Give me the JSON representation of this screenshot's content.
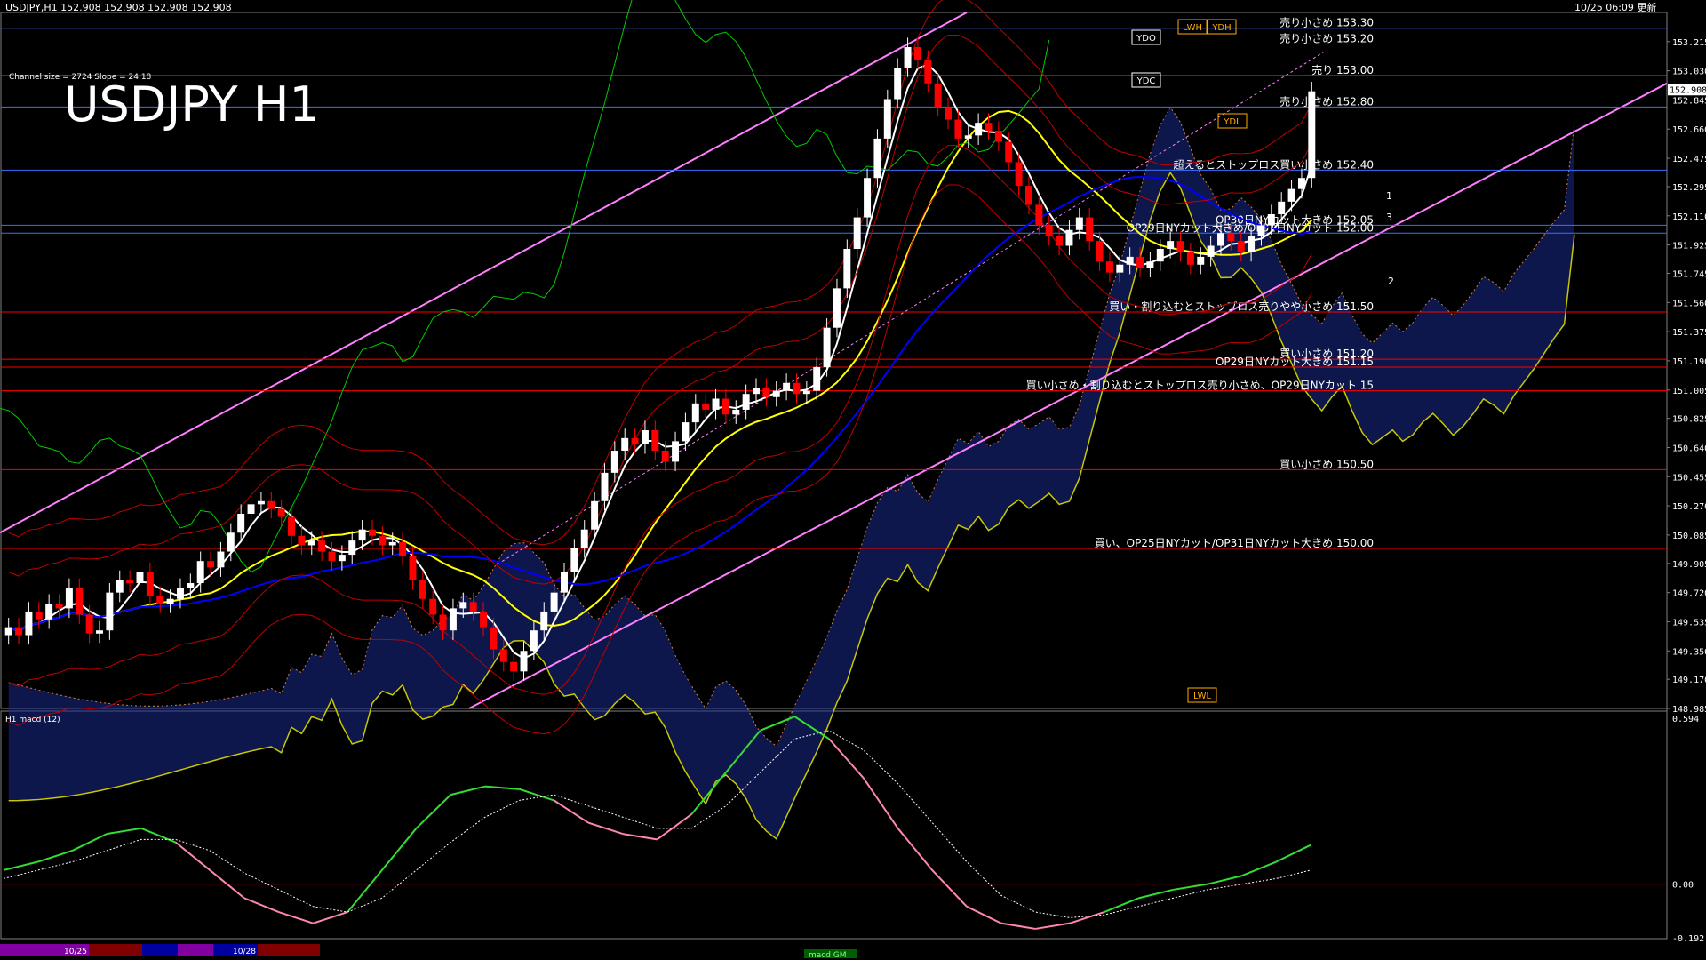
{
  "header": {
    "symbol_info": "USDJPY,H1  152.908 152.908 152.908 152.908",
    "timestamp": "10/25 06:09 更新",
    "channel_info": "Channel size = 2724 Slope = 24.18",
    "big_title": "USDJPY H1",
    "macd_label": "H1  macd (12)",
    "bottom_label": "macd GM",
    "bottom_dates": [
      "10/25",
      "10/28"
    ]
  },
  "chart_data": [
    {
      "type": "candlestick",
      "title": "USDJPY H1",
      "ylim": [
        148.985,
        153.4
      ],
      "y_ticks": [
        "153.215",
        "153.030",
        "152.845",
        "152.660",
        "152.475",
        "152.295",
        "152.110",
        "151.925",
        "151.745",
        "151.560",
        "151.375",
        "151.190",
        "151.005",
        "150.825",
        "150.640",
        "150.455",
        "150.270",
        "150.085",
        "149.905",
        "149.720",
        "149.535",
        "149.350",
        "149.170",
        "148.985"
      ],
      "current_price": "152.908",
      "current_price_value": 152.908,
      "candles": [
        149.5,
        149.45,
        149.6,
        149.55,
        149.65,
        149.62,
        149.75,
        149.58,
        149.46,
        149.48,
        149.72,
        149.8,
        149.78,
        149.85,
        149.7,
        149.65,
        149.68,
        149.75,
        149.78,
        149.92,
        149.88,
        149.98,
        150.1,
        150.22,
        150.28,
        150.3,
        150.25,
        150.2,
        150.08,
        150.02,
        150.05,
        149.98,
        149.92,
        149.96,
        150.05,
        150.12,
        150.08,
        150.02,
        150.04,
        149.95,
        149.8,
        149.68,
        149.58,
        149.48,
        149.62,
        149.66,
        149.6,
        149.5,
        149.36,
        149.28,
        149.22,
        149.35,
        149.48,
        149.6,
        149.72,
        149.85,
        150.0,
        150.12,
        150.3,
        150.48,
        150.62,
        150.7,
        150.66,
        150.75,
        150.62,
        150.55,
        150.68,
        150.8,
        150.92,
        150.88,
        150.95,
        150.85,
        150.88,
        150.98,
        151.02,
        150.96,
        151.0,
        151.05,
        150.98,
        151.0,
        151.15,
        151.4,
        151.65,
        151.9,
        152.1,
        152.35,
        152.6,
        152.85,
        153.05,
        153.18,
        153.1,
        152.95,
        152.8,
        152.72,
        152.6,
        152.62,
        152.7,
        152.65,
        152.58,
        152.45,
        152.3,
        152.18,
        152.05,
        151.98,
        151.92,
        152.02,
        152.1,
        151.95,
        151.82,
        151.75,
        151.8,
        151.85,
        151.78,
        151.82,
        151.9,
        151.95,
        151.88,
        151.8,
        151.85,
        151.92,
        152.0,
        151.95,
        151.88,
        151.98,
        152.05,
        152.12,
        152.2,
        152.28,
        152.35,
        152.9
      ],
      "level_lines": [
        {
          "price": 153.3,
          "label": "売り小さめ 153.30",
          "color": "#3b6fff"
        },
        {
          "price": 153.2,
          "label": "売り小さめ 153.20",
          "color": "#3b6fff"
        },
        {
          "price": 153.0,
          "label": "売り 153.00",
          "color": "#3b6fff"
        },
        {
          "price": 152.8,
          "label": "売り小さめ 152.80",
          "color": "#3b6fff"
        },
        {
          "price": 152.4,
          "label": "超えるとストップロス買い小さめ 152.40",
          "color": "#3b6fff"
        },
        {
          "price": 152.05,
          "label": "OP30日NYカット大きめ 152.05",
          "color": "#3b6fff"
        },
        {
          "price": 152.0,
          "label": "OP29日NYカット大きめ/OP31日NYカット 152.00",
          "color": "#3b6fff"
        },
        {
          "price": 151.5,
          "label": "買い・割り込むとストップロス売りやや小さめ 151.50",
          "color": "#ff0000"
        },
        {
          "price": 151.2,
          "label": "買い小さめ 151.20",
          "color": "#ff0000"
        },
        {
          "price": 151.15,
          "label": "OP29日NYカット大きめ 151.15",
          "color": "#ff0000"
        },
        {
          "price": 151.0,
          "label": "買い小さめ・割り込むとストップロス売り小さめ、OP29日NYカット 15",
          "color": "#ff0000"
        },
        {
          "price": 150.5,
          "label": "買い小さめ 150.50",
          "color": "#ff0000"
        },
        {
          "price": 150.0,
          "label": "買い、OP25日NYカット/OP31日NYカット大きめ 150.00",
          "color": "#ff0000"
        }
      ],
      "markers": [
        "YDO",
        "LWH",
        "YDH",
        "YDC",
        "YDL",
        "LWL"
      ],
      "fib_marks": [
        "1",
        "2",
        "3"
      ],
      "colors": {
        "up": "#ffffff",
        "down": "#ff0000",
        "channel": "#ff80ff",
        "ma_short": "#ffffff",
        "ma_mid": "#ffff00",
        "ma_long": "#0000ff",
        "green": "#00cc00"
      }
    },
    {
      "type": "line",
      "title": "H1  macd (12)",
      "ylim": [
        -0.192,
        0.594
      ],
      "y_ticks": [
        "0.594",
        "0.00",
        "-0.192"
      ],
      "series": [
        {
          "values": [
            0.05,
            0.08,
            0.12,
            0.18,
            0.2,
            0.15,
            0.05,
            -0.05,
            -0.1,
            -0.14,
            -0.1,
            0.05,
            0.2,
            0.32,
            0.35,
            0.34,
            0.3,
            0.22,
            0.18,
            0.16,
            0.25,
            0.4,
            0.55,
            0.6,
            0.52,
            0.38,
            0.2,
            0.05,
            -0.08,
            -0.14,
            -0.16,
            -0.14,
            -0.1,
            -0.05,
            -0.02,
            0.0,
            0.03,
            0.08,
            0.14
          ]
        },
        {
          "values": [
            0.02,
            0.05,
            0.08,
            0.12,
            0.16,
            0.16,
            0.12,
            0.04,
            -0.02,
            -0.08,
            -0.1,
            -0.05,
            0.05,
            0.15,
            0.24,
            0.3,
            0.32,
            0.28,
            0.24,
            0.2,
            0.2,
            0.28,
            0.4,
            0.52,
            0.55,
            0.48,
            0.36,
            0.22,
            0.08,
            -0.04,
            -0.1,
            -0.12,
            -0.11,
            -0.08,
            -0.05,
            -0.02,
            0.0,
            0.02,
            0.05
          ]
        }
      ]
    }
  ]
}
